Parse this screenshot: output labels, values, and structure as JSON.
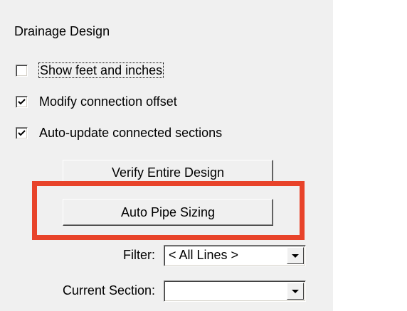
{
  "panel": {
    "title": "Drainage Design"
  },
  "checkboxes": [
    {
      "label": "Show feet and inches",
      "checked": false
    },
    {
      "label": "Modify connection offset",
      "checked": true
    },
    {
      "label": "Auto-update connected sections",
      "checked": true
    }
  ],
  "buttons": {
    "verify": "Verify Entire Design",
    "auto_pipe": "Auto Pipe Sizing"
  },
  "filter": {
    "label": "Filter:",
    "value": "< All Lines >"
  },
  "current_section": {
    "label": "Current Section:",
    "value": ""
  },
  "colors": {
    "highlight": "#e8432a",
    "panel": "#f0f0f0"
  },
  "icons": {
    "check": "check-icon",
    "dropdown": "chevron-down-icon"
  }
}
